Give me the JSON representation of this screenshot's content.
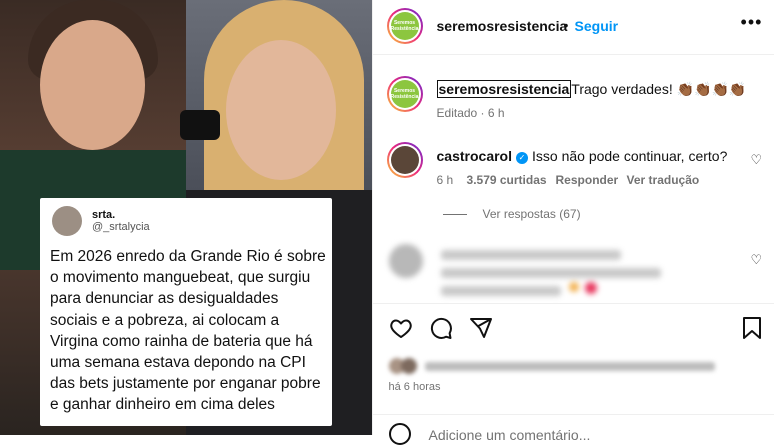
{
  "tweet": {
    "name": "srta.",
    "handle": "@_srtalycia",
    "text": "Em 2026 enredo da Grande Rio é sobre o movimento manguebeat, que surgiu para denunciar as desigualdades sociais e a pobreza, ai colocam a Virgina como rainha de bateria que há uma semana estava depondo na CPI das bets justamente por enganar pobre e ganhar dinheiro em cima deles"
  },
  "header": {
    "username": "seremosresistencia",
    "dot": "•",
    "follow_label": "Seguir",
    "more": "•••",
    "logo_text": "Seremos Resistência"
  },
  "caption": {
    "username": "seremosresistencia",
    "text": "Trago verdades! 👏🏾👏🏾👏🏾👏🏾",
    "meta": "Editado · 6 h"
  },
  "comment1": {
    "username": "castrocarol",
    "verified_mark": "✓",
    "text": "Isso não pode continuar, certo?",
    "time": "6 h",
    "likes": "3.579 curtidas",
    "reply": "Responder",
    "translate": "Ver tradução"
  },
  "replies_label": "Ver respostas (67)",
  "post": {
    "time": "há 6 horas",
    "add_comment_placeholder": "Adicione um comentário..."
  },
  "icons": {
    "heart": "♡"
  }
}
